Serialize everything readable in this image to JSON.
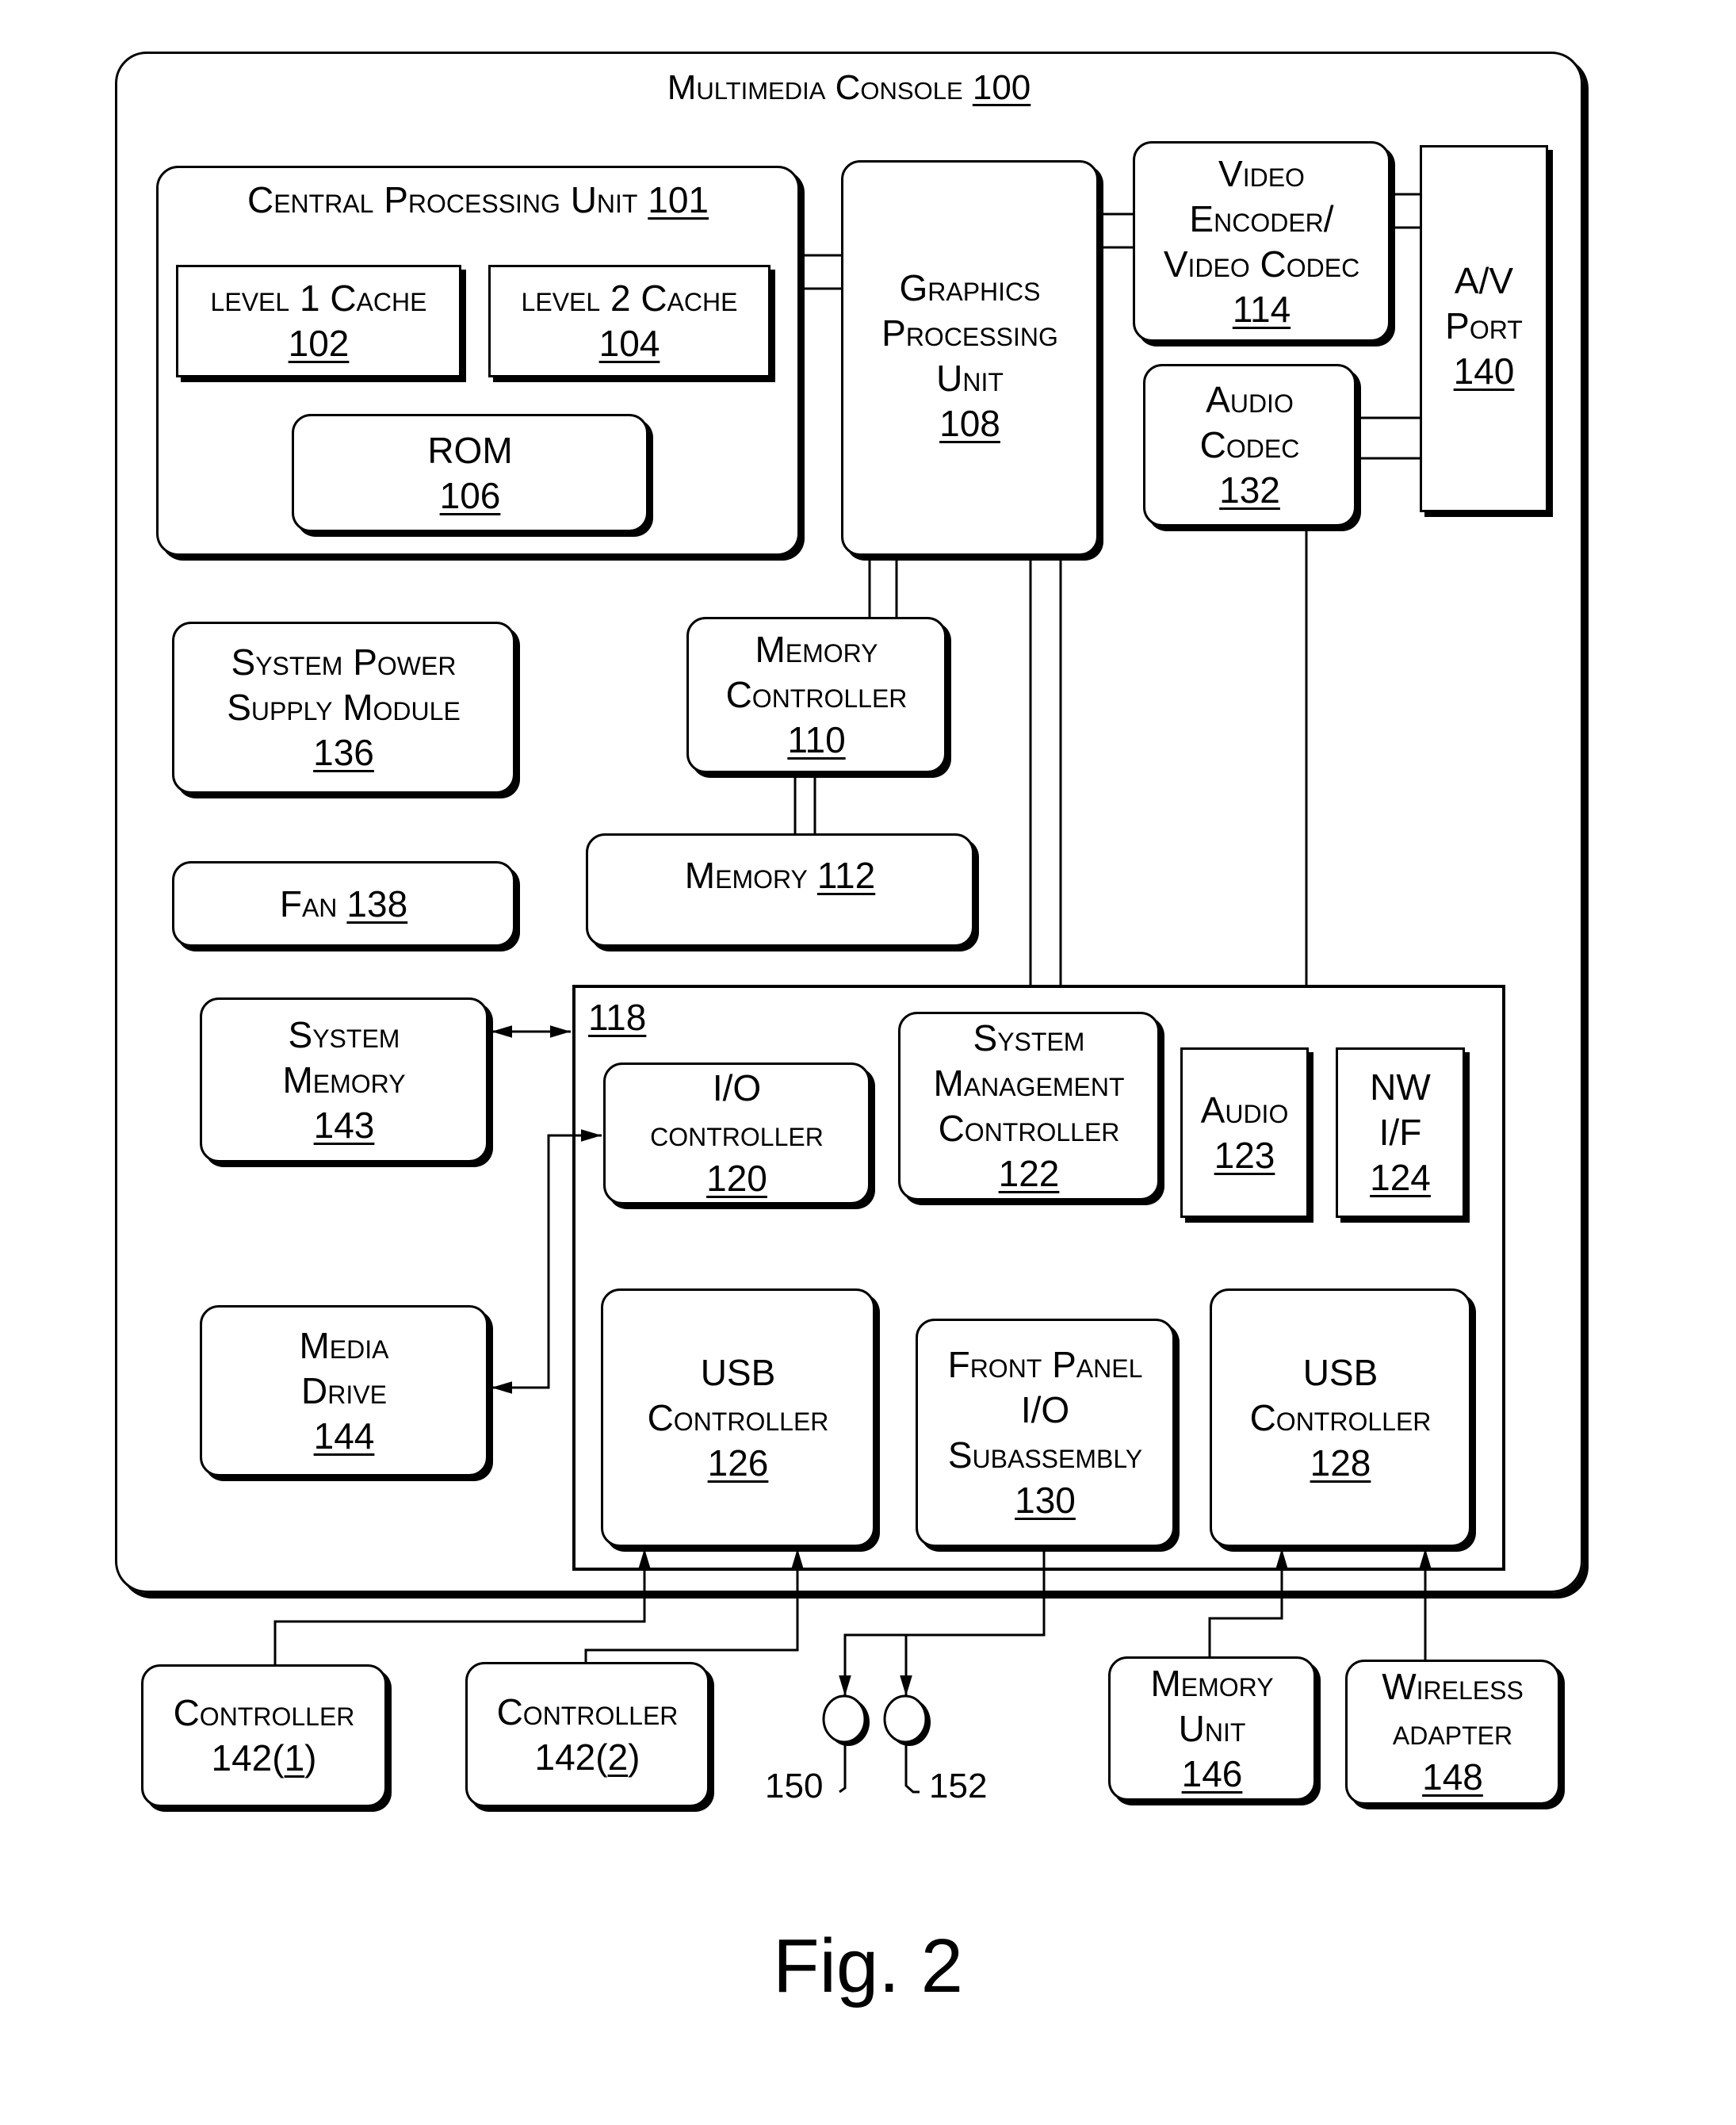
{
  "figure_label": "Fig. 2",
  "console": {
    "label": "Multimedia Console",
    "ref": "100"
  },
  "cpu": {
    "label": "Central Processing Unit",
    "ref": "101"
  },
  "blocks": {
    "l1_cache": {
      "label": "level 1 Cache",
      "ref": "102"
    },
    "l2_cache": {
      "label": "level 2 Cache",
      "ref": "104"
    },
    "rom": {
      "label": "ROM",
      "ref": "106"
    },
    "gpu": {
      "label": "Graphics\nProcessing\nUnit",
      "ref": "108"
    },
    "video_encoder": {
      "label": "Video\nEncoder/\nVideo Codec",
      "ref": "114"
    },
    "audio_codec": {
      "label": "Audio\nCodec",
      "ref": "132"
    },
    "av_port": {
      "label": "A/V\nPort",
      "ref": "140"
    },
    "power_supply": {
      "label": "System Power\nSupply Module",
      "ref": "136"
    },
    "memory_controller": {
      "label": "Memory\nController",
      "ref": "110"
    },
    "fan": {
      "label": "Fan",
      "ref": "138"
    },
    "memory": {
      "label": "Memory",
      "ref": "112"
    },
    "system_memory": {
      "label": "System\nMemory",
      "ref": "143"
    },
    "media_drive": {
      "label": "Media\nDrive",
      "ref": "144"
    },
    "io_hub": {
      "ref": "118"
    },
    "io_controller": {
      "label": "I/O\ncontroller",
      "ref": "120"
    },
    "system_management_controller": {
      "label": "System\nManagement\nController",
      "ref": "122"
    },
    "audio": {
      "label": "Audio",
      "ref": "123"
    },
    "nw_if": {
      "label": "NW\nI/F",
      "ref": "124"
    },
    "usb_controller_1": {
      "label": "USB\nController",
      "ref": "126"
    },
    "front_panel": {
      "label": "Front Panel\nI/O\nSubassembly",
      "ref": "130"
    },
    "usb_controller_2": {
      "label": "USB\nController",
      "ref": "128"
    }
  },
  "external": {
    "controller_1": {
      "label": "Controller",
      "ref_prefix": "142(",
      "ref_index": "1",
      "ref_suffix": ")"
    },
    "controller_2": {
      "label": "Controller",
      "ref_prefix": "142(",
      "ref_index": "2",
      "ref_suffix": ")"
    },
    "indicator_150": {
      "ref": "150"
    },
    "indicator_152": {
      "ref": "152"
    },
    "memory_unit": {
      "label": "Memory\nUnit",
      "ref": "146"
    },
    "wireless_adapter": {
      "label": "Wireless\nadapter",
      "ref": "148"
    }
  }
}
